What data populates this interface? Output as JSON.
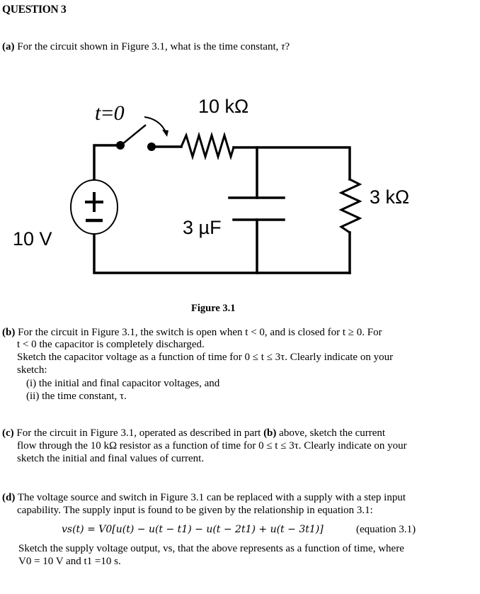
{
  "heading": "QUESTION 3",
  "part_a": {
    "label": "(a)",
    "text": " For the circuit shown in Figure 3.1, what is the time constant, ",
    "symbol": "τ",
    "end": "?"
  },
  "figure": {
    "caption": "Figure 3.1",
    "switch_label": "t=0",
    "resistor_series_label": "10 kΩ",
    "resistor_shunt_label": "3 kΩ",
    "capacitor_label": "3 µF",
    "source_label": "10 V",
    "source_plus": "+",
    "source_minus": "−"
  },
  "part_b": {
    "label": "(b)",
    "line1": " For the circuit in Figure 3.1, the switch is open when t < 0, and is closed for t ≥ 0. For",
    "line2": "t < 0 the capacitor is completely discharged.",
    "line3": "Sketch the capacitor voltage as a function of time for 0 ≤ t ≤ 3τ. Clearly indicate on your",
    "line4": "sketch:",
    "item1": "(i) the initial and final capacitor voltages, and",
    "item2": "(ii) the time constant, τ."
  },
  "part_c": {
    "label": "(c)",
    "line1_pre": " For the circuit in Figure 3.1, operated as described in part ",
    "line1_bold": "(b)",
    "line1_post": " above, sketch the current",
    "line2": "flow through the 10 kΩ resistor as a function of time for 0 ≤ t ≤ 3τ. Clearly indicate on your",
    "line3": "sketch the initial and final values of current."
  },
  "part_d": {
    "label": "(d)",
    "line1": " The voltage source and switch in Figure 3.1 can be replaced with a supply with a step input",
    "line2": "capability. The supply input is found to be given by the relationship in equation 3.1:",
    "equation": "vs(t) = V0[u(t) − u(t − t1) − u(t − 2t1) + u(t − 3t1)]",
    "equation_tag": "(equation 3.1)",
    "line3": "Sketch the supply voltage output, vs, that the above represents as a function of time, where",
    "line4": "V0 = 10 V and t1 =10 s."
  }
}
